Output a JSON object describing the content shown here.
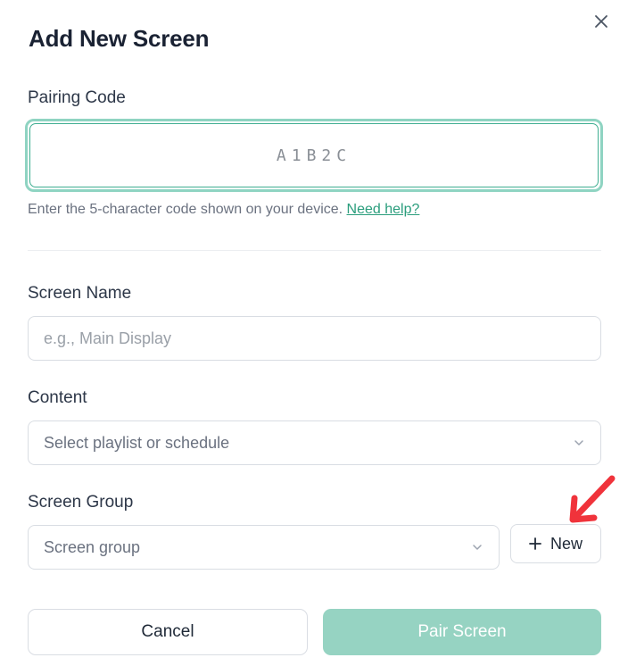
{
  "dialog": {
    "title": "Add New Screen",
    "close_icon": "close-icon"
  },
  "pairing": {
    "label": "Pairing Code",
    "placeholder": "A1B2C",
    "helper_text": "Enter the 5-character code shown on your device.",
    "help_link": "Need help?"
  },
  "screen_name": {
    "label": "Screen Name",
    "placeholder": "e.g., Main Display"
  },
  "content": {
    "label": "Content",
    "selected": "Select playlist or schedule"
  },
  "screen_group": {
    "label": "Screen Group",
    "selected": "Screen group",
    "new_button": "New"
  },
  "actions": {
    "cancel": "Cancel",
    "pair": "Pair Screen"
  },
  "colors": {
    "accent": "#3fae91",
    "accent_light": "#96d3c2",
    "annotation_arrow": "#f0333b"
  }
}
